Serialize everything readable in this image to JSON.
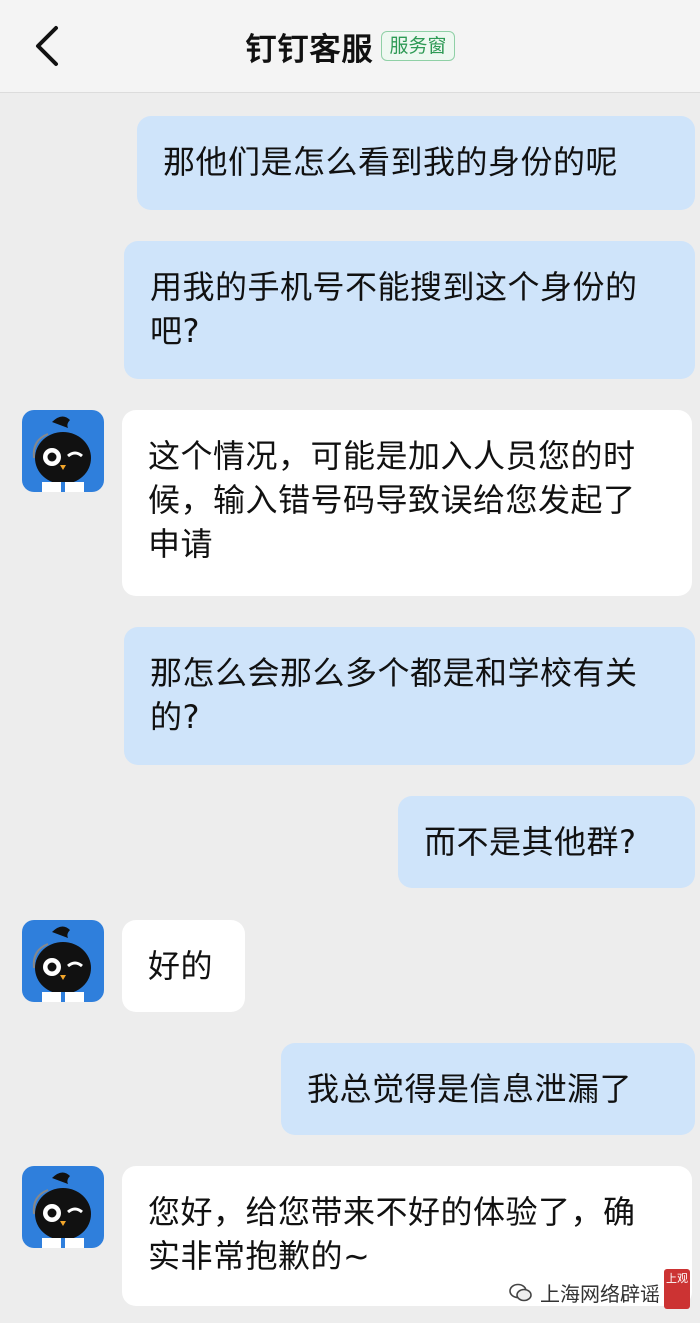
{
  "header": {
    "back_icon": "chevron-left-icon",
    "title": "钉钉客服",
    "badge": "服务窗"
  },
  "messages": [
    {
      "from": "user",
      "text": "那他们是怎么看到我的身份的呢"
    },
    {
      "from": "user",
      "text": "用我的手机号不能搜到这个身份的吧?"
    },
    {
      "from": "bot",
      "text": "这个情况，可能是加入人员您的时候，输入错号码导致误给您发起了申请"
    },
    {
      "from": "user",
      "text": "那怎么会那么多个都是和学校有关的?"
    },
    {
      "from": "user",
      "text": "而不是其他群?"
    },
    {
      "from": "bot",
      "text": "好的"
    },
    {
      "from": "user",
      "text": "我总觉得是信息泄漏了"
    },
    {
      "from": "bot",
      "text": "您好，给您带来不好的体验了，确实非常抱歉的~"
    }
  ],
  "watermark": {
    "icon": "wechat-icon",
    "text": "上海网络辟谣",
    "seal_text": "上观"
  },
  "colors": {
    "user_bubble": "#cfe4fa",
    "bot_bubble": "#ffffff",
    "background": "#ededed",
    "badge_green": "#2e9a55",
    "avatar_blue": "#2f7fdc"
  }
}
